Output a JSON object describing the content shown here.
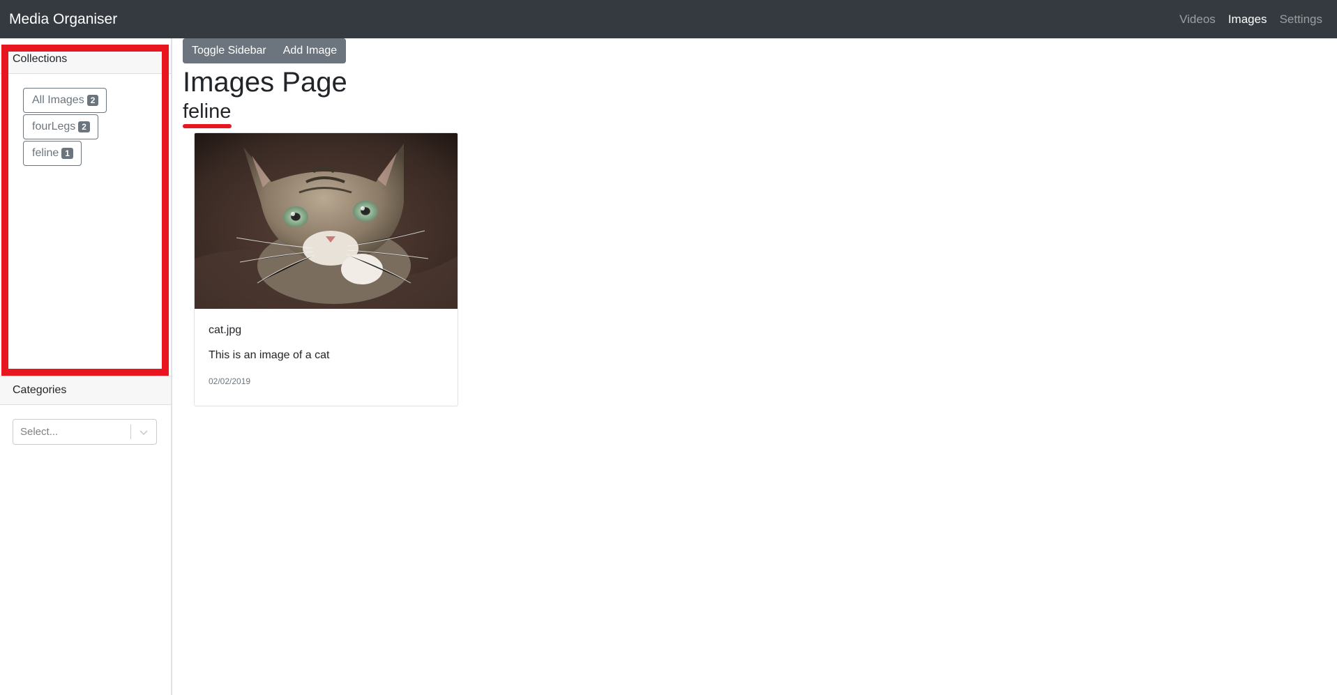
{
  "navbar": {
    "brand": "Media Organiser",
    "links": [
      {
        "label": "Videos",
        "active": false
      },
      {
        "label": "Images",
        "active": true
      },
      {
        "label": "Settings",
        "active": false
      }
    ]
  },
  "sidebar": {
    "collections_header": "Collections",
    "collections": [
      {
        "label": "All Images",
        "count": "2"
      },
      {
        "label": "fourLegs",
        "count": "2"
      },
      {
        "label": "feline",
        "count": "1"
      }
    ],
    "categories_header": "Categories",
    "categories_select": {
      "placeholder": "Select..."
    }
  },
  "toolbar": {
    "toggle_sidebar_label": "Toggle Sidebar",
    "add_image_label": "Add Image"
  },
  "main": {
    "page_title": "Images Page",
    "collection_title": "feline",
    "cards": [
      {
        "title": "cat.jpg",
        "description": "This is an image of a cat",
        "date": "02/02/2019",
        "image_alt": "cat photo"
      }
    ]
  },
  "colors": {
    "navbar_bg": "#343a40",
    "secondary": "#6c757d",
    "highlight_red": "#e8161f"
  }
}
